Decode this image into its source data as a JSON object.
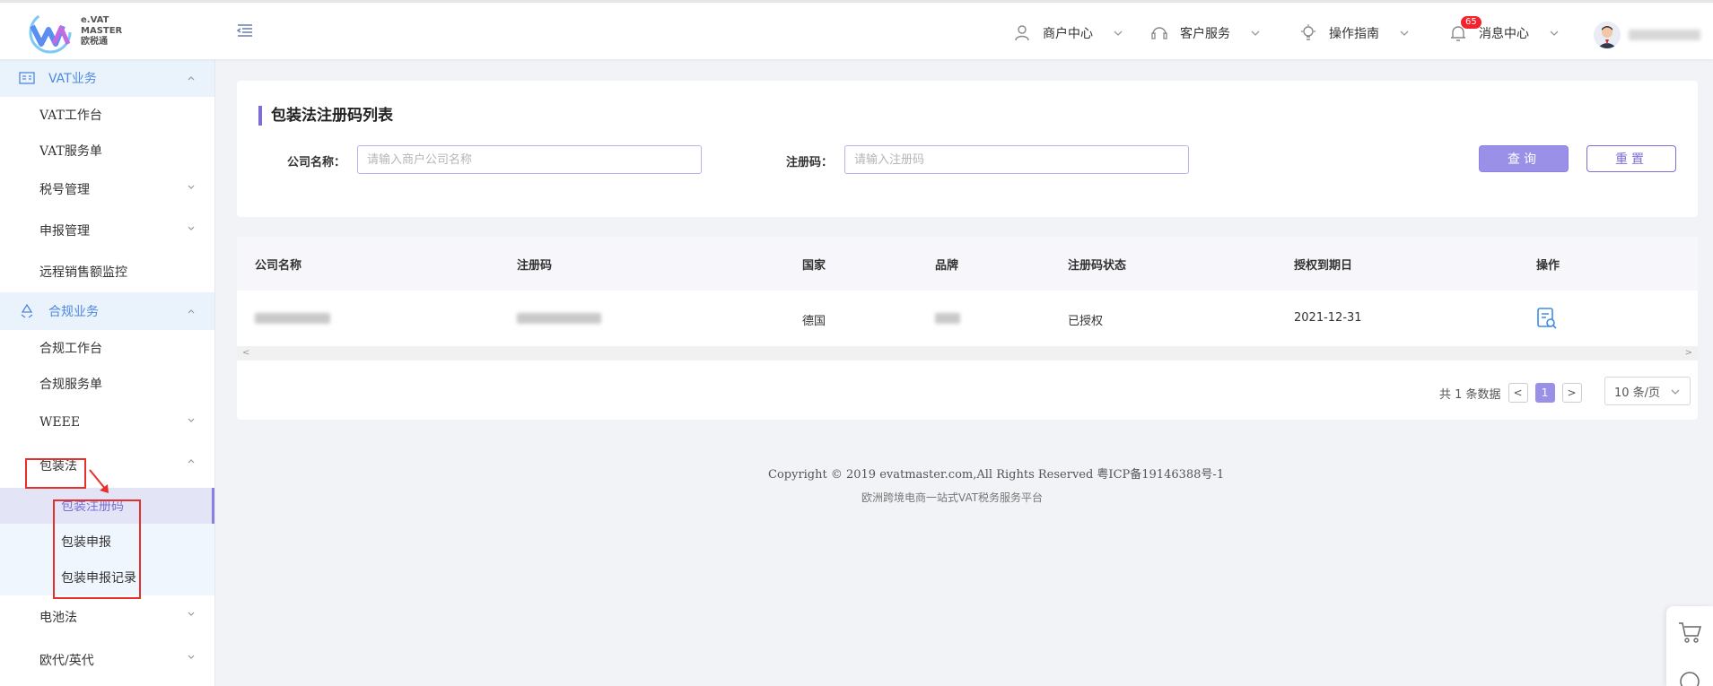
{
  "header": {
    "logo_line1": "e.VAT",
    "logo_line2": "MASTER",
    "logo_line3": "欧税通",
    "merchant_center": "商户中心",
    "customer_service": "客户服务",
    "guide": "操作指南",
    "messages": "消息中心",
    "message_count": "65"
  },
  "sidebar": {
    "vat_group": "VAT业务",
    "vat_items": [
      "VAT工作台",
      "VAT服务单",
      "税号管理",
      "申报管理",
      "远程销售额监控"
    ],
    "compliance_group": "合规业务",
    "compliance_items": [
      "合规工作台",
      "合规服务单",
      "WEEE",
      "包装法"
    ],
    "packaging_sub": [
      "包装注册码",
      "包装申报",
      "包装申报记录"
    ],
    "more_items": [
      "电池法",
      "欧代/英代"
    ]
  },
  "search": {
    "title": "包装法注册码列表",
    "company_label": "公司名称：",
    "company_placeholder": "请输入商户公司名称",
    "regcode_label": "注册码：",
    "regcode_placeholder": "请输入注册码",
    "query_btn": "查询",
    "reset_btn": "重置"
  },
  "table": {
    "columns": [
      "公司名称",
      "注册码",
      "国家",
      "品牌",
      "注册码状态",
      "授权到期日",
      "操作"
    ],
    "rows": [
      {
        "country": "德国",
        "status": "已授权",
        "expiry": "2021-12-31"
      }
    ]
  },
  "pagination": {
    "total": "共 1 条数据",
    "current": "1",
    "page_size": "10 条/页"
  },
  "footer": {
    "copyright": "Copyright © 2019 evatmaster.com,All Rights Reserved 粤ICP备19146388号-1",
    "slogan": "欧洲跨境电商一站式VAT税务服务平台"
  },
  "colors": {
    "accent": "#7b6fd6",
    "primary_button": "#9b90e8",
    "sidebar_active": "#4e88e0",
    "highlight_box": "#e4312b"
  }
}
